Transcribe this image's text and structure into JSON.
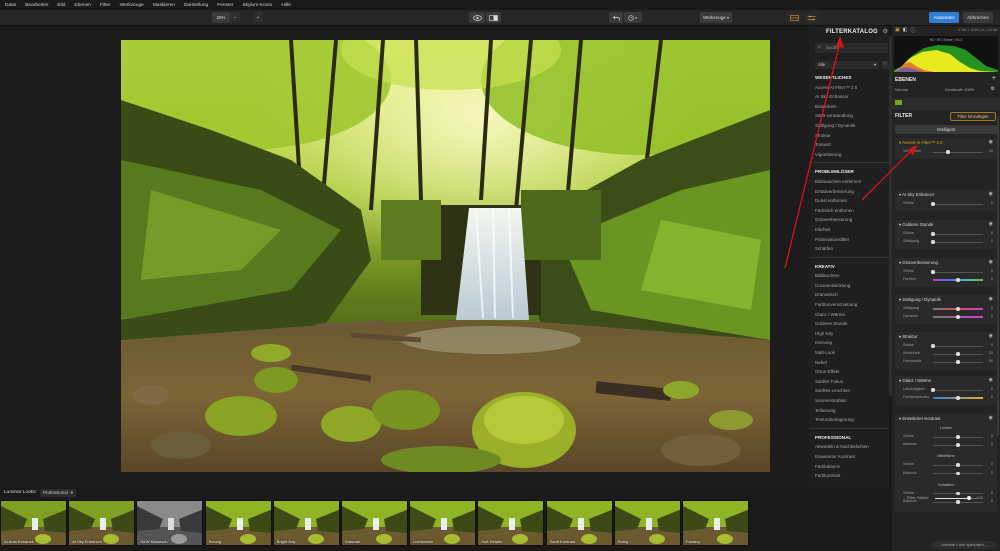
{
  "menu": [
    "Datei",
    "Bearbeiten",
    "Bild",
    "Ebenen",
    "Filter",
    "Werkzeuge",
    "Maskieren",
    "Darstellung",
    "Fenster",
    "Skylum-Konto",
    "Hilfe"
  ],
  "toolbar": {
    "zoom": "29%",
    "minus": "−",
    "plus": "+",
    "eye_icon": "eye-icon",
    "split_icon": "split-view-icon",
    "undo_icon": "undo-icon",
    "history_icon": "history-icon",
    "workspace": "Werkzeuge",
    "apply": "Anwenden",
    "cancel": "Abbrechen"
  },
  "catalog": {
    "title": "FILTERKATALOG",
    "search_placeholder": "Suche",
    "select": "Alle",
    "groups": [
      {
        "title": "WESENTLICHES",
        "items": [
          "Accent AI Filter™ 2.0",
          "AI Sky Enhancer",
          "Entwickeln",
          "S&W-Umwandlung",
          "Sättigung / Dynamik",
          "Struktur",
          "Tonwert",
          "Vignettierung"
        ]
      },
      {
        "title": "PROBLEMLÖSER",
        "items": [
          "Bildrauschen entfernen",
          "Detailverbesserung",
          "Dunst entfernen",
          "Farbstich entfernen",
          "Grünverbesserung",
          "Klarheit",
          "Polarisationsfilter",
          "Schärfen"
        ]
      },
      {
        "title": "KREATIV",
        "items": [
          "Bildleuchten",
          "Crossentwicklung",
          "Dramatisch",
          "Farbtonverschiebung",
          "Glanz / Wärme",
          "Goldene Stunde",
          "High Key",
          "Körnung",
          "Matt-Look",
          "Nebel",
          "Orton-Effekt",
          "Sanfter Fokus",
          "Sanftes Leuchten",
          "Sonnenstrahlen",
          "Teiltonung",
          "Texturüberlagerung"
        ]
      },
      {
        "title": "PROFESSIONAL",
        "items": [
          "Abwedeln & Nachbelichten",
          "Erweiterter Kontrast",
          "Farbbalance",
          "Farbkontrast"
        ]
      }
    ]
  },
  "panel": {
    "info": "5746 × 4160 px  |  16-bit",
    "histogram_text": "90 / 90  |  Sieve  |  93.3",
    "layers_title": "EBENEN",
    "blend_mode": "Normal",
    "opacity": "Deckkraft: 100%",
    "filter_title": "FILTER",
    "filter_add": "Filter hinzufügen",
    "smart": "Intelligent",
    "filters": [
      {
        "title": "Accent AI Filter™ 2.0",
        "sliders": [
          {
            "label": "Verstärken",
            "value": "30",
            "pos": 0.3
          }
        ]
      },
      {
        "title": "AI Sky Enhancer",
        "sliders": [
          {
            "label": "Stärke",
            "value": "0",
            "pos": 0.0
          }
        ]
      },
      {
        "title": "Goldene Stunde",
        "sliders": [
          {
            "label": "Stärke",
            "value": "0",
            "pos": 0.0
          },
          {
            "label": "Sättigung",
            "value": "0",
            "pos": 0.0
          }
        ]
      },
      {
        "title": "Grünverbesserung",
        "sliders": [
          {
            "label": "Stärke",
            "value": "0",
            "pos": 0.0
          },
          {
            "label": "Farbton",
            "value": "0",
            "pos": 0.5
          }
        ]
      },
      {
        "title": "Sättigung / Dynamik",
        "sliders": [
          {
            "label": "Sättigung",
            "value": "0",
            "pos": 0.5
          },
          {
            "label": "Dynamik",
            "value": "0",
            "pos": 0.5
          }
        ]
      },
      {
        "title": "Struktur",
        "sliders": [
          {
            "label": "Stärke",
            "value": "0",
            "pos": 0.0
          },
          {
            "label": "Weichheit",
            "value": "50",
            "pos": 0.5
          },
          {
            "label": "Feindetails",
            "value": "50",
            "pos": 0.5
          }
        ]
      },
      {
        "title": "Glanz / Wärme",
        "sliders": [
          {
            "label": "Lebendigkeit",
            "value": "0",
            "pos": 0.0
          },
          {
            "label": "Farbtemperatur",
            "value": "0",
            "pos": 0.5
          }
        ]
      },
      {
        "title": "Erweiterter Kontrast",
        "sections": [
          {
            "title": "Lichter",
            "sliders": [
              {
                "label": "Stärke",
                "value": "0",
                "pos": 0.5
              },
              {
                "label": "Balance",
                "value": "0",
                "pos": 0.5
              }
            ]
          },
          {
            "title": "Mitteltöne",
            "sliders": [
              {
                "label": "Stärke",
                "value": "0",
                "pos": 0.5
              },
              {
                "label": "Balance",
                "value": "0",
                "pos": 0.5
              }
            ]
          },
          {
            "title": "Schatten",
            "sliders": [
              {
                "label": "Stärke",
                "value": "0",
                "pos": 0.5
              },
              {
                "label": "Balance",
                "value": "0",
                "pos": 0.5
              }
            ]
          }
        ]
      }
    ],
    "filter_strength_label": "Filter Stärke",
    "filter_strength_value": "100",
    "filter_strength": 1.0,
    "save_look": "Luminar Look speichern..."
  },
  "looks": {
    "header": "Luminar Looks:",
    "category": "Professional",
    "items": [
      "AI Auto Enhance",
      "AI Sky Enhancer",
      "S&W Klassisch",
      "Sonnig",
      "Bright Day",
      "Saturate",
      "Lichtschein",
      "Soft Details",
      "Sanft Kontrast",
      "Ruhig",
      "Fantasy"
    ]
  },
  "colors": {
    "accent": "#2e7ed6",
    "orange": "#e39f2b",
    "annotation": "#d8141c"
  }
}
